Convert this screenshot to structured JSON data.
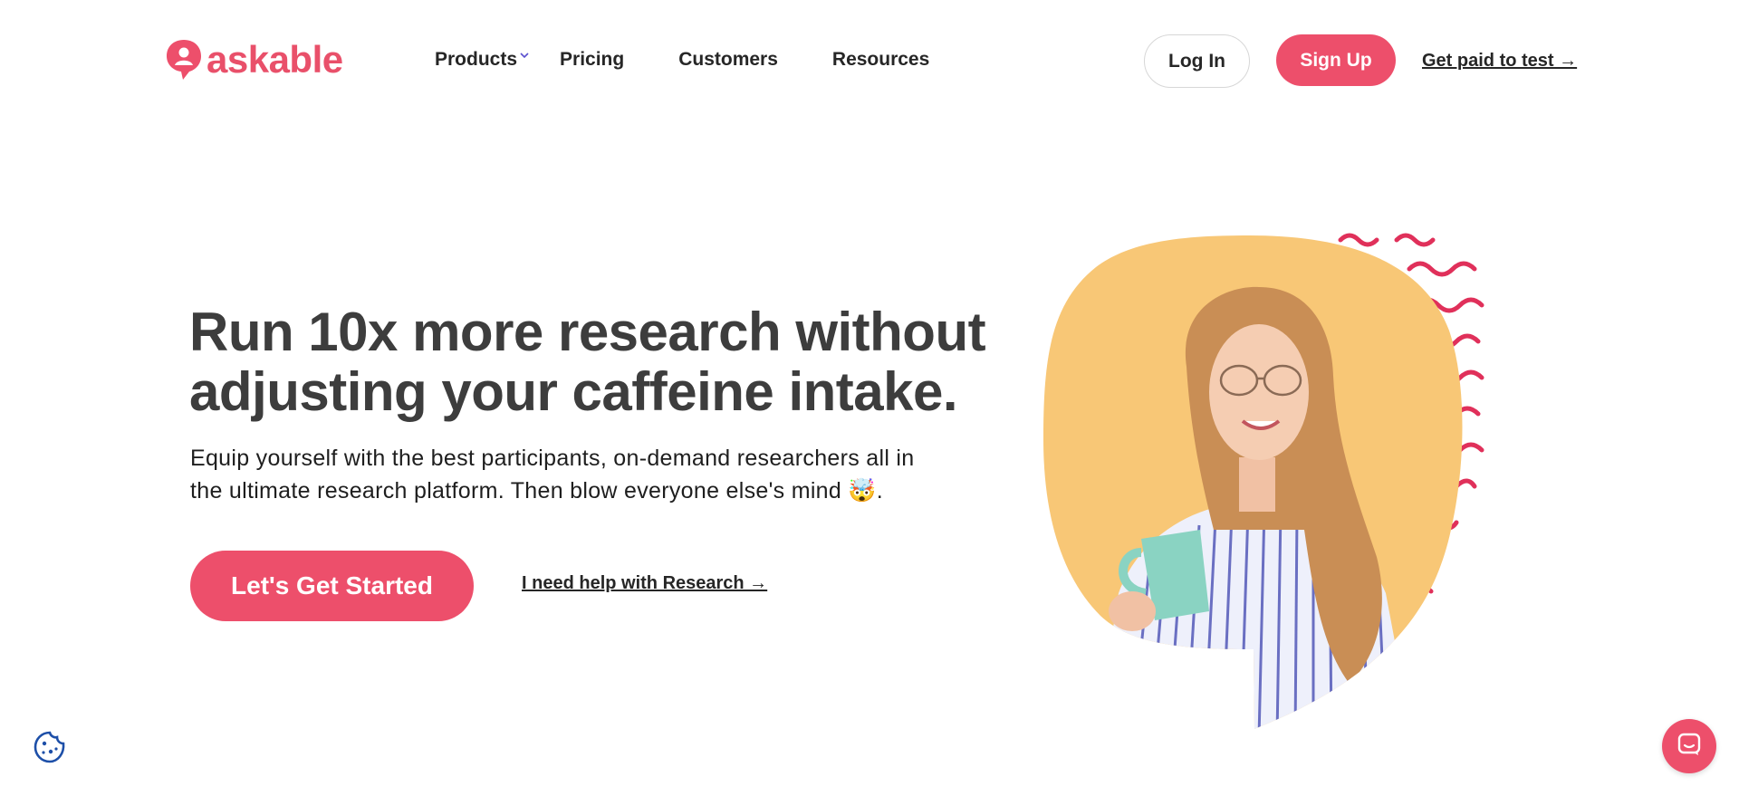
{
  "header": {
    "logo_text": "askable",
    "nav": {
      "products": "Products",
      "pricing": "Pricing",
      "customers": "Customers",
      "resources": "Resources"
    },
    "login_label": "Log In",
    "signup_label": "Sign Up",
    "paid_link": "Get paid to test →"
  },
  "hero": {
    "title_line1": "Run 10x more research without",
    "title_line2": "adjusting your caffeine intake.",
    "subtitle_line1": "Equip yourself with the best participants, on-demand researchers all in",
    "subtitle_line2": "the ultimate research platform. Then blow everyone else's mind 🤯.",
    "cta_label": "Let's Get Started",
    "help_link": "I need help with Research →"
  },
  "colors": {
    "brand": "#ed4f6b",
    "squiggle": "#e0305a",
    "blob": "#f8c776",
    "text_dark": "#3d3d3d",
    "chevron": "#5a4fcf",
    "cookie": "#1d4fa8"
  },
  "icons": {
    "logo": "askable-logo-icon",
    "products_dropdown": "chevron-down-icon",
    "cookie": "cookie-icon",
    "chat": "chat-icon"
  }
}
